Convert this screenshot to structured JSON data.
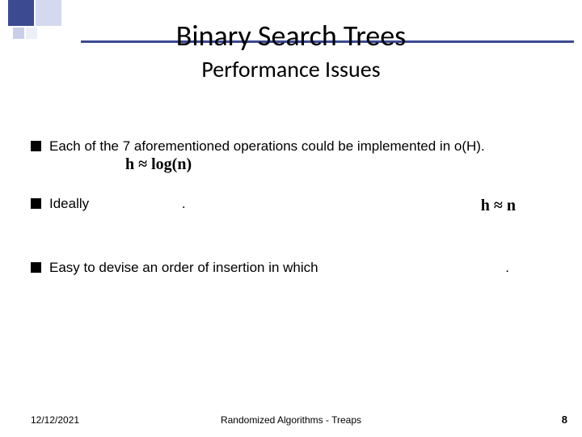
{
  "title": "Binary Search Trees",
  "subtitle": "Performance Issues",
  "bullets": [
    {
      "text": "Each of the 7 aforementioned operations could be implemented in o(H).",
      "overlay": "h ≈ log(n)"
    },
    {
      "text": "Ideally",
      "trail": ".",
      "formula_right": "h ≈ n"
    },
    {
      "text": "Easy to devise an order of insertion in which",
      "trail": "."
    }
  ],
  "footer": {
    "date": "12/12/2021",
    "center": "Randomized Algorithms - Treaps",
    "page": "8"
  }
}
